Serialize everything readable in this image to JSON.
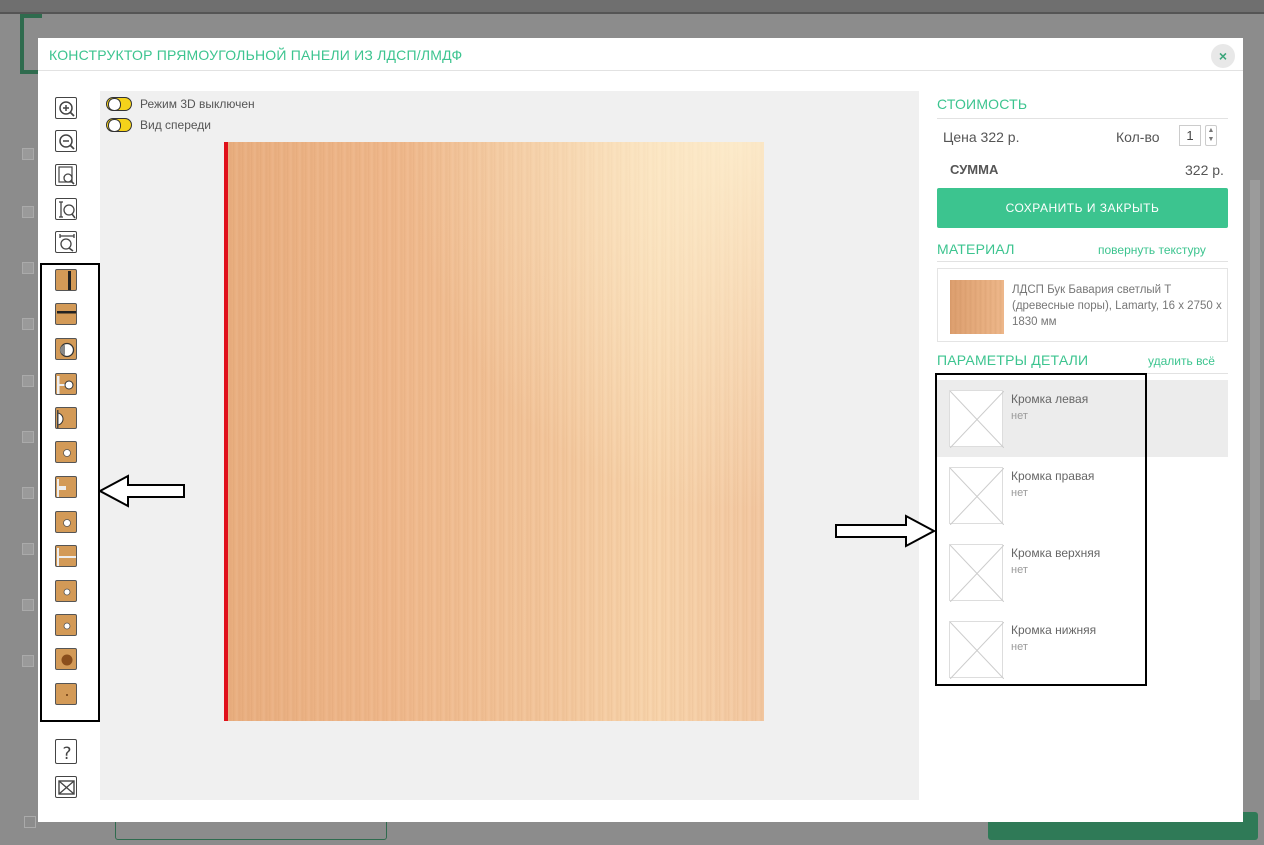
{
  "modal": {
    "title": "КОНСТРУКТОР ПРЯМОУГОЛЬНОЙ ПАНЕЛИ ИЗ ЛДСП/ЛМДФ",
    "close_icon": "×"
  },
  "toolbar": {
    "zoom_tools": [
      "zoom-in-icon",
      "zoom-out-icon",
      "zoom-fit-icon",
      "zoom-height-icon",
      "zoom-width-icon"
    ],
    "operation_tools": [
      "edge-vertical-cut-icon",
      "edge-horizontal-cut-icon",
      "hole-large-icon",
      "hole-side-icon",
      "hole-edge-icon",
      "hole-small-icon",
      "slot-side-icon",
      "hole-small-2-icon",
      "groove-side-icon",
      "hole-small-3-icon",
      "hole-small-4-icon",
      "hole-filled-icon",
      "point-icon"
    ],
    "help_label": "?",
    "close_icon": "envelope-close-icon"
  },
  "canvas": {
    "toggle_3d_label": "Режим 3D выключен",
    "toggle_view_label": "Вид спереди"
  },
  "cost": {
    "title": "СТОИМОСТЬ",
    "price_label": "Цена 322 р.",
    "qty_label": "Кол-во",
    "qty_value": "1",
    "sum_label": "СУММА",
    "sum_value": "322 р.",
    "save_button": "СОХРАНИТЬ И ЗАКРЫТЬ"
  },
  "material": {
    "title": "МАТЕРИАЛ",
    "rotate_link": "повернуть текстуру",
    "name": "ЛДСП Бук Бавария светлый Т (древесные поры), Lamarty, 16 х 2750 х 1830 мм"
  },
  "params": {
    "title": "ПАРАМЕТРЫ ДЕТАЛИ",
    "delete_all_link": "удалить всё",
    "items": [
      {
        "name": "Кромка левая",
        "value": "нет"
      },
      {
        "name": "Кромка правая",
        "value": "нет"
      },
      {
        "name": "Кромка верхняя",
        "value": "нет"
      },
      {
        "name": "Кромка нижняя",
        "value": "нет"
      }
    ]
  },
  "colors": {
    "accent": "#3cc48f",
    "edge_red": "#e0101a",
    "toggle_yellow": "#f5d21a"
  }
}
